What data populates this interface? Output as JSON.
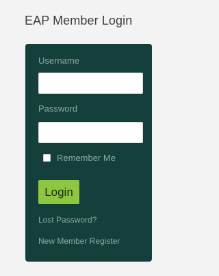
{
  "widget": {
    "title": "EAP Member Login"
  },
  "form": {
    "username_label": "Username",
    "username_value": "",
    "password_label": "Password",
    "password_value": "",
    "remember_label": "Remember Me",
    "remember_checked": false,
    "login_label": "Login",
    "lost_password_label": "Lost Password?",
    "register_label": "New Member Register"
  },
  "colors": {
    "page_background": "#f3f3f3",
    "panel_background": "#143f3b",
    "label_text": "#8ca9a3",
    "login_button": "#8dc63f"
  }
}
